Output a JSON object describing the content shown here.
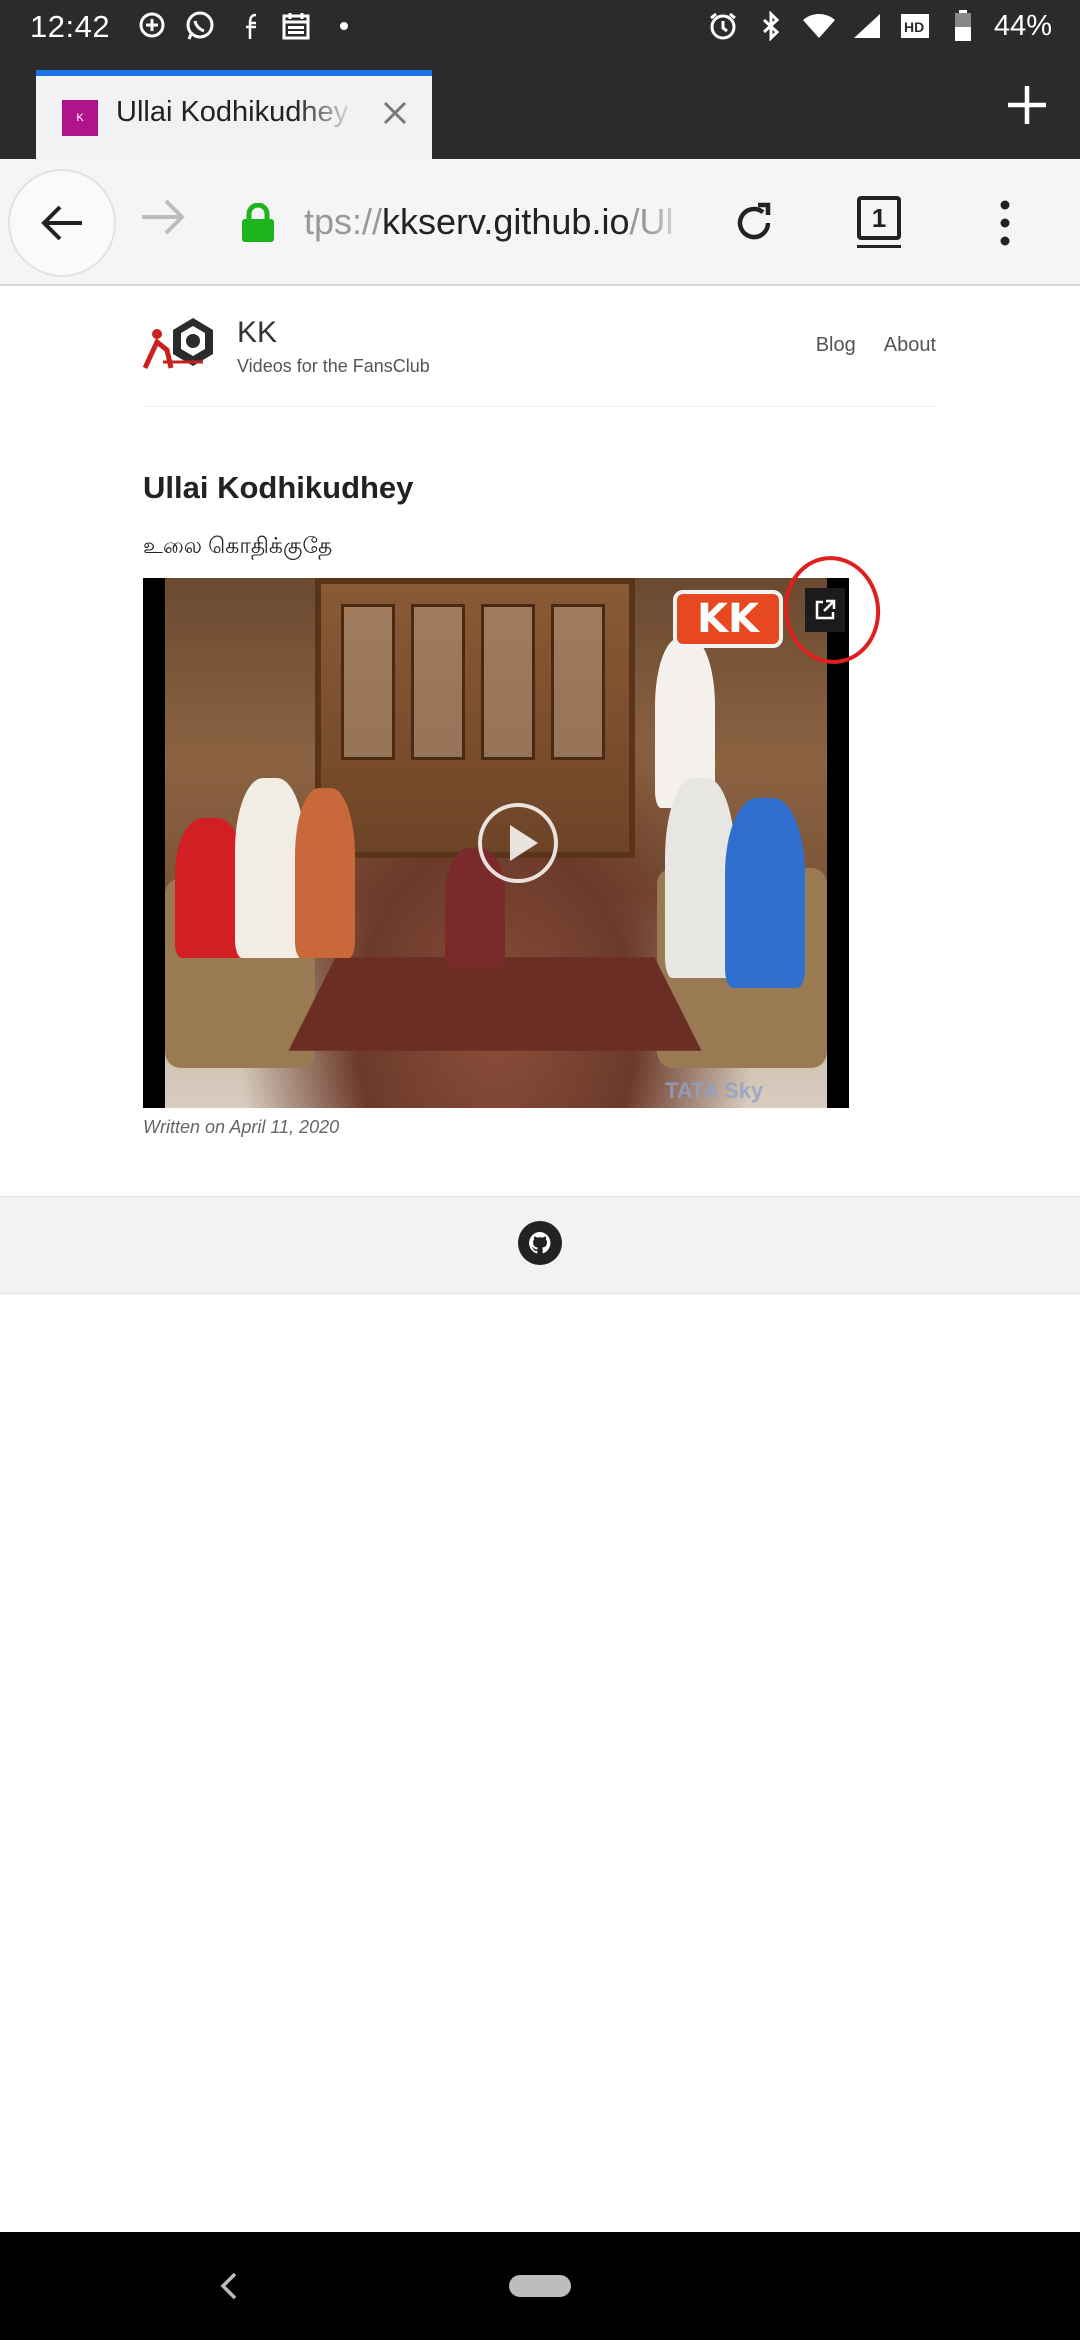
{
  "status_bar": {
    "time": "12:42",
    "battery": "44%",
    "left_icons": [
      "maps-icon",
      "whatsapp-icon",
      "facebook-icon",
      "calendar-icon",
      "dot-icon"
    ],
    "right_icons": [
      "alarm-icon",
      "bluetooth-icon",
      "wifi-icon",
      "signal-icon",
      "hd-icon",
      "battery-icon"
    ]
  },
  "browser": {
    "tab_title": "Ullai Kodhikudhey",
    "tab_favicon_letter": "K",
    "url_prefix": "tps://",
    "url_host": "kkserv.github.io",
    "url_path": "/Ul",
    "tab_count": "1",
    "colors": {
      "favicon": "#b0148c",
      "lock": "#1db41d",
      "tab_indicator": "#1a73e8"
    }
  },
  "site": {
    "name": "KK",
    "description": "Videos for the FansClub",
    "nav": [
      "Blog",
      "About"
    ]
  },
  "post": {
    "title": "Ullai Kodhikudhey",
    "subtitle_tamil": "உலை கொதிக்குதே",
    "video": {
      "badge_text": "KK",
      "watermark": "TATA Sky",
      "annotation_color": "#e0201f"
    },
    "date": "Written on April 11, 2020"
  },
  "footer": {
    "icon": "github-icon"
  }
}
